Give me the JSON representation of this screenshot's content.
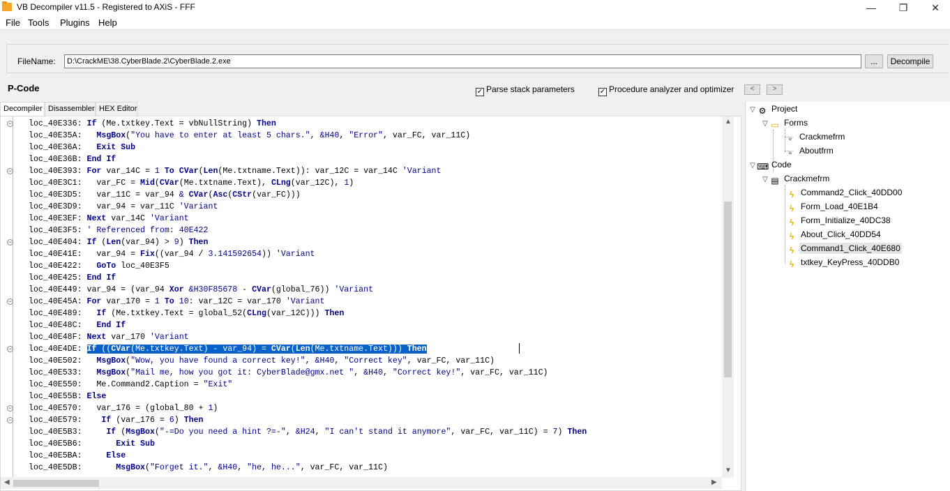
{
  "window": {
    "title": "VB Decompiler v11.5 - Registered to AXiS - FFF",
    "minimize": "—",
    "maximize": "❐",
    "close": "✕"
  },
  "menu": [
    "File",
    "Tools",
    "Plugins",
    "Help"
  ],
  "filename": {
    "label": "FileName:",
    "value": "D:\\CrackME\\38.CyberBlade.2\\CyberBlade.2.exe",
    "browse_label": "...",
    "decompile_label": "Decompile"
  },
  "pcode_label": "P-Code",
  "options": {
    "parse_stack": "Parse stack parameters",
    "procedure_analyzer": "Procedure analyzer and optimizer",
    "prev": "<",
    "next": ">"
  },
  "tabs": [
    "Decompiler",
    "Disassembler",
    "HEX Editor"
  ],
  "code_lines": [
    {
      "addr": "loc_40E336:",
      "indent": 0,
      "parts": [
        [
          "k",
          "If"
        ],
        [
          "t",
          " (Me.txtkey.Text = vbNullString) "
        ],
        [
          "k",
          "Then"
        ]
      ]
    },
    {
      "addr": "loc_40E35A:",
      "indent": 2,
      "parts": [
        [
          "k",
          "MsgBox"
        ],
        [
          "t",
          "("
        ],
        [
          "s",
          "\"You have to enter at least 5 chars.\""
        ],
        [
          "t",
          ", "
        ],
        [
          "s",
          "&H40"
        ],
        [
          "t",
          ", "
        ],
        [
          "s",
          "\"Error\""
        ],
        [
          "t",
          ", var_FC, var_11C)"
        ]
      ]
    },
    {
      "addr": "loc_40E36A:",
      "indent": 2,
      "parts": [
        [
          "k",
          "Exit Sub"
        ]
      ]
    },
    {
      "addr": "loc_40E36B:",
      "indent": 0,
      "parts": [
        [
          "k",
          "End If"
        ]
      ]
    },
    {
      "addr": "loc_40E393:",
      "indent": 0,
      "parts": [
        [
          "k",
          "For"
        ],
        [
          "t",
          " var_14C = "
        ],
        [
          "s",
          "1"
        ],
        [
          "t",
          " "
        ],
        [
          "k",
          "To"
        ],
        [
          "t",
          " "
        ],
        [
          "k",
          "CVar"
        ],
        [
          "t",
          "("
        ],
        [
          "k",
          "Len"
        ],
        [
          "t",
          "(Me.txtname.Text)): var_12C = var_14C "
        ],
        [
          "c",
          "'Variant"
        ]
      ]
    },
    {
      "addr": "loc_40E3C1:",
      "indent": 2,
      "parts": [
        [
          "t",
          "var_FC = "
        ],
        [
          "k",
          "Mid"
        ],
        [
          "t",
          "("
        ],
        [
          "k",
          "CVar"
        ],
        [
          "t",
          "(Me.txtname.Text), "
        ],
        [
          "k",
          "CLng"
        ],
        [
          "t",
          "(var_12C), "
        ],
        [
          "s",
          "1"
        ],
        [
          "t",
          ")"
        ]
      ]
    },
    {
      "addr": "loc_40E3D5:",
      "indent": 2,
      "parts": [
        [
          "t",
          "var_11C = var_94 "
        ],
        [
          "s",
          "&"
        ],
        [
          "t",
          " "
        ],
        [
          "k",
          "CVar"
        ],
        [
          "t",
          "("
        ],
        [
          "k",
          "Asc"
        ],
        [
          "t",
          "("
        ],
        [
          "k",
          "CStr"
        ],
        [
          "t",
          "(var_FC)))"
        ]
      ]
    },
    {
      "addr": "loc_40E3D9:",
      "indent": 2,
      "parts": [
        [
          "t",
          "var_94 = var_11C "
        ],
        [
          "c",
          "'Variant"
        ]
      ]
    },
    {
      "addr": "loc_40E3EF:",
      "indent": 0,
      "parts": [
        [
          "k",
          "Next"
        ],
        [
          "t",
          " var_14C "
        ],
        [
          "c",
          "'Variant"
        ]
      ]
    },
    {
      "addr": "loc_40E3F5:",
      "indent": 0,
      "parts": [
        [
          "c",
          "' Referenced from: 40E422"
        ]
      ]
    },
    {
      "addr": "loc_40E404:",
      "indent": 0,
      "parts": [
        [
          "k",
          "If"
        ],
        [
          "t",
          " ("
        ],
        [
          "k",
          "Len"
        ],
        [
          "t",
          "(var_94) > "
        ],
        [
          "s",
          "9"
        ],
        [
          "t",
          ") "
        ],
        [
          "k",
          "Then"
        ]
      ]
    },
    {
      "addr": "loc_40E41E:",
      "indent": 2,
      "parts": [
        [
          "t",
          "var_94 = "
        ],
        [
          "k",
          "Fix"
        ],
        [
          "t",
          "((var_94 / "
        ],
        [
          "s",
          "3.141592654"
        ],
        [
          "t",
          ")) "
        ],
        [
          "c",
          "'Variant"
        ]
      ]
    },
    {
      "addr": "loc_40E422:",
      "indent": 2,
      "parts": [
        [
          "k",
          "GoTo"
        ],
        [
          "t",
          " loc_40E3F5"
        ]
      ]
    },
    {
      "addr": "loc_40E425:",
      "indent": 0,
      "parts": [
        [
          "k",
          "End If"
        ]
      ]
    },
    {
      "addr": "loc_40E449:",
      "indent": 0,
      "parts": [
        [
          "t",
          "var_94 = (var_94 "
        ],
        [
          "k",
          "Xor"
        ],
        [
          "t",
          " "
        ],
        [
          "s",
          "&H30F85678"
        ],
        [
          "t",
          " - "
        ],
        [
          "k",
          "CVar"
        ],
        [
          "t",
          "(global_76)) "
        ],
        [
          "c",
          "'Variant"
        ]
      ]
    },
    {
      "addr": "loc_40E45A:",
      "indent": 0,
      "parts": [
        [
          "k",
          "For"
        ],
        [
          "t",
          " var_170 = "
        ],
        [
          "s",
          "1"
        ],
        [
          "t",
          " "
        ],
        [
          "k",
          "To"
        ],
        [
          "t",
          " "
        ],
        [
          "s",
          "10"
        ],
        [
          "t",
          ": var_12C = var_170 "
        ],
        [
          "c",
          "'Variant"
        ]
      ]
    },
    {
      "addr": "loc_40E489:",
      "indent": 2,
      "parts": [
        [
          "k",
          "If"
        ],
        [
          "t",
          " (Me.txtkey.Text = global_52("
        ],
        [
          "k",
          "CLng"
        ],
        [
          "t",
          "(var_12C))) "
        ],
        [
          "k",
          "Then"
        ]
      ]
    },
    {
      "addr": "loc_40E48C:",
      "indent": 2,
      "parts": [
        [
          "k",
          "End If"
        ]
      ]
    },
    {
      "addr": "loc_40E48F:",
      "indent": 0,
      "parts": [
        [
          "k",
          "Next"
        ],
        [
          "t",
          " var_170 "
        ],
        [
          "c",
          "'Variant"
        ]
      ]
    },
    {
      "addr": "loc_40E4DE:",
      "indent": 0,
      "selected": true,
      "parts": [
        [
          "k",
          "If"
        ],
        [
          "t",
          " (("
        ],
        [
          "k",
          "CVar"
        ],
        [
          "t",
          "(Me.txtkey.Text) - var_94) = "
        ],
        [
          "k",
          "CVar"
        ],
        [
          "t",
          "("
        ],
        [
          "k",
          "Len"
        ],
        [
          "t",
          "(Me.txtname.Text))) "
        ],
        [
          "k",
          "Then"
        ]
      ]
    },
    {
      "addr": "loc_40E502:",
      "indent": 2,
      "parts": [
        [
          "k",
          "MsgBox"
        ],
        [
          "t",
          "("
        ],
        [
          "s",
          "\"Wow, you have found a correct key!\""
        ],
        [
          "t",
          ", "
        ],
        [
          "s",
          "&H40"
        ],
        [
          "t",
          ", "
        ],
        [
          "s",
          "\"Correct key\""
        ],
        [
          "t",
          ", var_FC, var_11C)"
        ]
      ]
    },
    {
      "addr": "loc_40E533:",
      "indent": 2,
      "parts": [
        [
          "k",
          "MsgBox"
        ],
        [
          "t",
          "("
        ],
        [
          "s",
          "\"Mail me, how you got it: CyberBlade@gmx.net \""
        ],
        [
          "t",
          ", "
        ],
        [
          "s",
          "&H40"
        ],
        [
          "t",
          ", "
        ],
        [
          "s",
          "\"Correct key!\""
        ],
        [
          "t",
          ", var_FC, var_11C)"
        ]
      ]
    },
    {
      "addr": "loc_40E550:",
      "indent": 2,
      "parts": [
        [
          "t",
          "Me.Command2.Caption = "
        ],
        [
          "s",
          "\"Exit\""
        ]
      ]
    },
    {
      "addr": "loc_40E55B:",
      "indent": 0,
      "parts": [
        [
          "k",
          "Else"
        ]
      ]
    },
    {
      "addr": "loc_40E570:",
      "indent": 2,
      "parts": [
        [
          "t",
          "var_176 = (global_80 + "
        ],
        [
          "s",
          "1"
        ],
        [
          "t",
          ")"
        ]
      ]
    },
    {
      "addr": "loc_40E579:",
      "indent": 3,
      "parts": [
        [
          "k",
          "If"
        ],
        [
          "t",
          " (var_176 = "
        ],
        [
          "s",
          "6"
        ],
        [
          "t",
          ") "
        ],
        [
          "k",
          "Then"
        ]
      ]
    },
    {
      "addr": "loc_40E5B3:",
      "indent": 4,
      "parts": [
        [
          "k",
          "If"
        ],
        [
          "t",
          " ("
        ],
        [
          "k",
          "MsgBox"
        ],
        [
          "t",
          "("
        ],
        [
          "s",
          "\"-=Do you need a hint ?=-\""
        ],
        [
          "t",
          ", "
        ],
        [
          "s",
          "&H24"
        ],
        [
          "t",
          ", "
        ],
        [
          "s",
          "\"I can't stand it anymore\""
        ],
        [
          "t",
          ", var_FC, var_11C) = "
        ],
        [
          "s",
          "7"
        ],
        [
          "t",
          ") "
        ],
        [
          "k",
          "Then"
        ]
      ]
    },
    {
      "addr": "loc_40E5B6:",
      "indent": 6,
      "parts": [
        [
          "k",
          "Exit Sub"
        ]
      ]
    },
    {
      "addr": "loc_40E5BA:",
      "indent": 4,
      "parts": [
        [
          "k",
          "Else"
        ]
      ]
    },
    {
      "addr": "loc_40E5DB:",
      "indent": 6,
      "parts": [
        [
          "k",
          "MsgBox"
        ],
        [
          "t",
          "("
        ],
        [
          "s",
          "\"Forget it.\""
        ],
        [
          "t",
          ", "
        ],
        [
          "s",
          "&H40"
        ],
        [
          "t",
          ", "
        ],
        [
          "s",
          "\"he, he...\""
        ],
        [
          "t",
          ", var_FC, var_11C)"
        ]
      ]
    }
  ],
  "tree": {
    "project": "Project",
    "forms": "Forms",
    "form_items": [
      "Crackmefrm",
      "Aboutfrm"
    ],
    "code": "Code",
    "module": "Crackmefrm",
    "procedures": [
      "Command2_Click_40DD00",
      "Form_Load_40E1B4",
      "Form_Initialize_40DC38",
      "About_Click_40DD54",
      "Command1_Click_40E680",
      "txtkey_KeyPress_40DDB0"
    ],
    "selected_index": 4
  },
  "colors": {
    "keyword": "#00008b",
    "selection": "#0a62c9",
    "folder": "#f5c242",
    "event_icon": "#e8b400"
  }
}
